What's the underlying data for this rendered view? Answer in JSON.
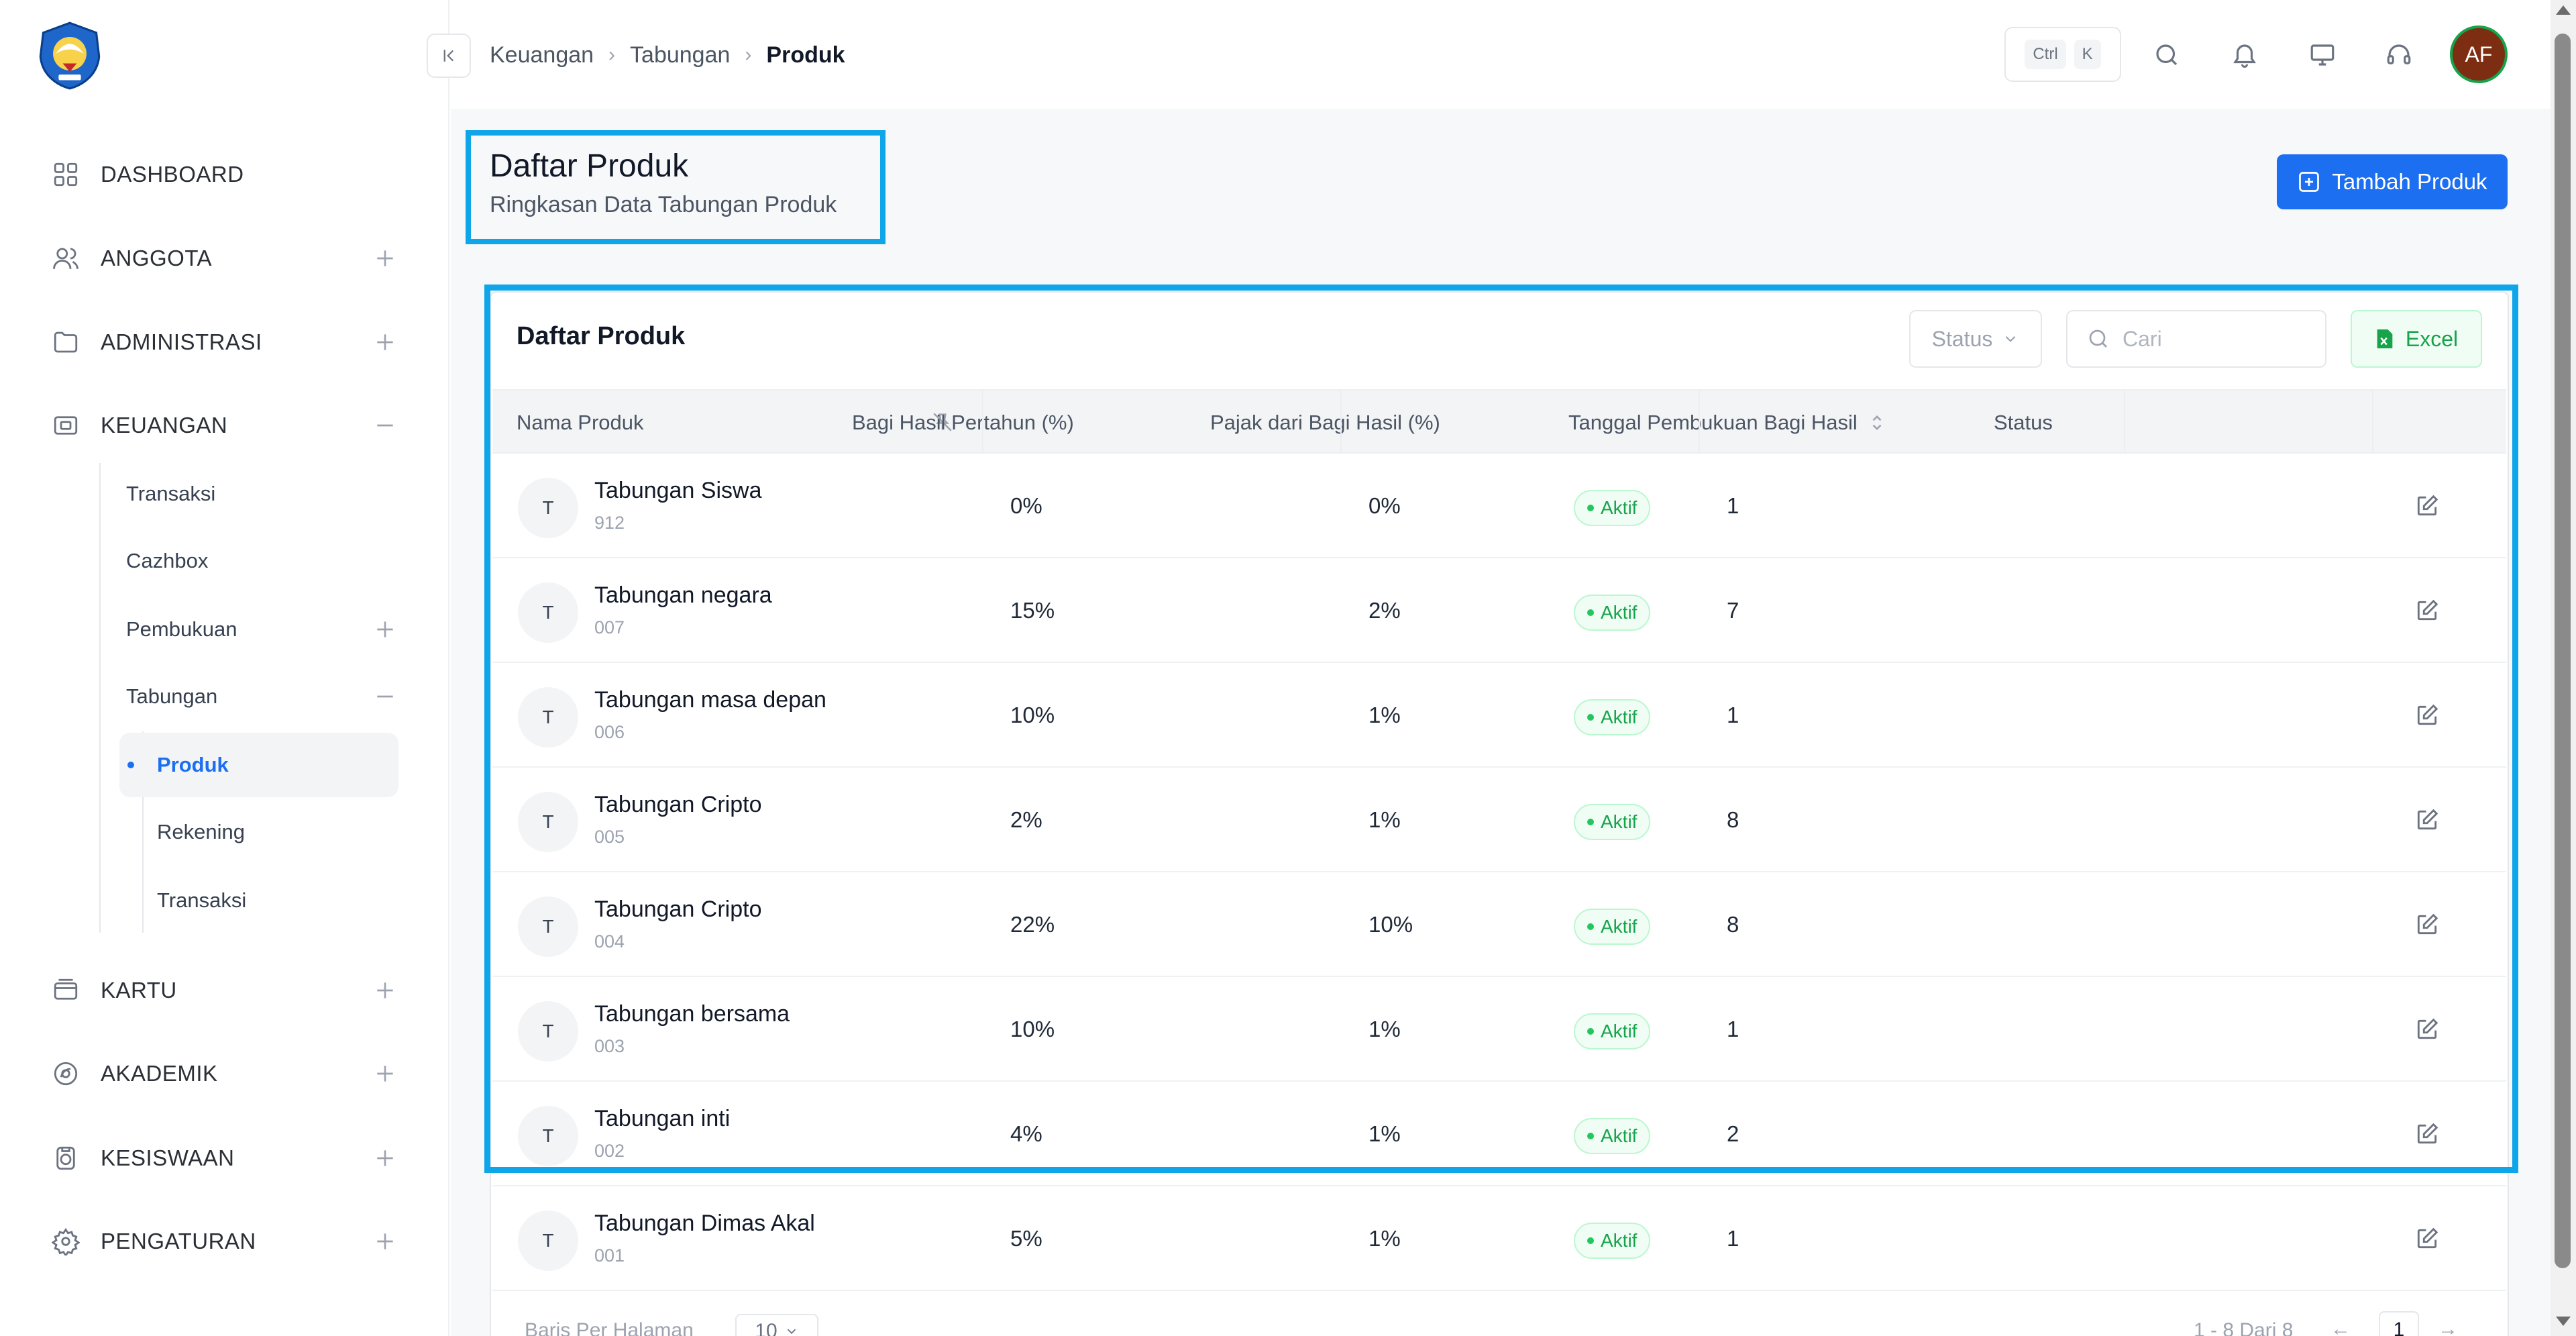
{
  "sidebar": {
    "logo": "tut-wuri-handayani-logo",
    "items": [
      {
        "label": "DASHBOARD",
        "icon": "grid-icon",
        "toggle": ""
      },
      {
        "label": "ANGGOTA",
        "icon": "users-icon",
        "toggle": "+"
      },
      {
        "label": "ADMINISTRASI",
        "icon": "folder-icon",
        "toggle": "+"
      },
      {
        "label": "KEUANGAN",
        "icon": "wallet-icon",
        "toggle": "−"
      },
      {
        "label": "KARTU",
        "icon": "card-icon",
        "toggle": "+"
      },
      {
        "label": "AKADEMIK",
        "icon": "academic-icon",
        "toggle": "+"
      },
      {
        "label": "KESISWAAN",
        "icon": "student-icon",
        "toggle": "+"
      },
      {
        "label": "PENGATURAN",
        "icon": "gear-icon",
        "toggle": "+"
      }
    ],
    "keuangan_sub": [
      {
        "label": "Transaksi"
      },
      {
        "label": "Cazhbox"
      },
      {
        "label": "Pembukuan",
        "toggle": "+"
      },
      {
        "label": "Tabungan",
        "toggle": "−"
      }
    ],
    "tabungan_sub": [
      {
        "label": "Produk",
        "active": true
      },
      {
        "label": "Rekening"
      },
      {
        "label": "Transaksi"
      }
    ]
  },
  "header": {
    "breadcrumb": [
      "Keuangan",
      "Tabungan",
      "Produk"
    ],
    "shortcut": [
      "Ctrl",
      "K"
    ],
    "icons": [
      "search-icon",
      "bell-icon",
      "monitor-icon",
      "headset-icon"
    ],
    "avatar_initials": "AF"
  },
  "page": {
    "title": "Daftar Produk",
    "subtitle": "Ringkasan Data Tabungan Produk",
    "add_button": "Tambah Produk"
  },
  "card": {
    "title": "Daftar Produk",
    "status_filter": "Status",
    "search_placeholder": "Cari",
    "excel_button": "Excel"
  },
  "table": {
    "columns": [
      "Nama Produk",
      "Bagi Hasil Pertahun (%)",
      "Pajak dari Bagi Hasil (%)",
      "Tanggal Pembukuan Bagi Hasil",
      "Status"
    ],
    "rows": [
      {
        "avatar": "T",
        "name": "Tabungan Siswa",
        "code": "912",
        "bagi_hasil": "0%",
        "pajak": "0%",
        "tanggal": "1",
        "status": "Aktif"
      },
      {
        "avatar": "T",
        "name": "Tabungan negara",
        "code": "007",
        "bagi_hasil": "15%",
        "pajak": "2%",
        "tanggal": "7",
        "status": "Aktif"
      },
      {
        "avatar": "T",
        "name": "Tabungan masa depan",
        "code": "006",
        "bagi_hasil": "10%",
        "pajak": "1%",
        "tanggal": "1",
        "status": "Aktif"
      },
      {
        "avatar": "T",
        "name": "Tabungan Cripto",
        "code": "005",
        "bagi_hasil": "2%",
        "pajak": "1%",
        "tanggal": "8",
        "status": "Aktif"
      },
      {
        "avatar": "T",
        "name": "Tabungan Cripto",
        "code": "004",
        "bagi_hasil": "22%",
        "pajak": "10%",
        "tanggal": "8",
        "status": "Aktif"
      },
      {
        "avatar": "T",
        "name": "Tabungan bersama",
        "code": "003",
        "bagi_hasil": "10%",
        "pajak": "1%",
        "tanggal": "1",
        "status": "Aktif"
      },
      {
        "avatar": "T",
        "name": "Tabungan inti",
        "code": "002",
        "bagi_hasil": "4%",
        "pajak": "1%",
        "tanggal": "2",
        "status": "Aktif"
      },
      {
        "avatar": "T",
        "name": "Tabungan Dimas Akal",
        "code": "001",
        "bagi_hasil": "5%",
        "pajak": "1%",
        "tanggal": "1",
        "status": "Aktif"
      }
    ]
  },
  "footer": {
    "rows_per_page_label": "Baris Per Halaman",
    "rows_per_page": "10",
    "range": "1 - 8 Dari 8",
    "page": "1"
  },
  "colors": {
    "accent": "#1d6ff2",
    "highlight": "#0ea5e9",
    "success": "#16a34a"
  }
}
